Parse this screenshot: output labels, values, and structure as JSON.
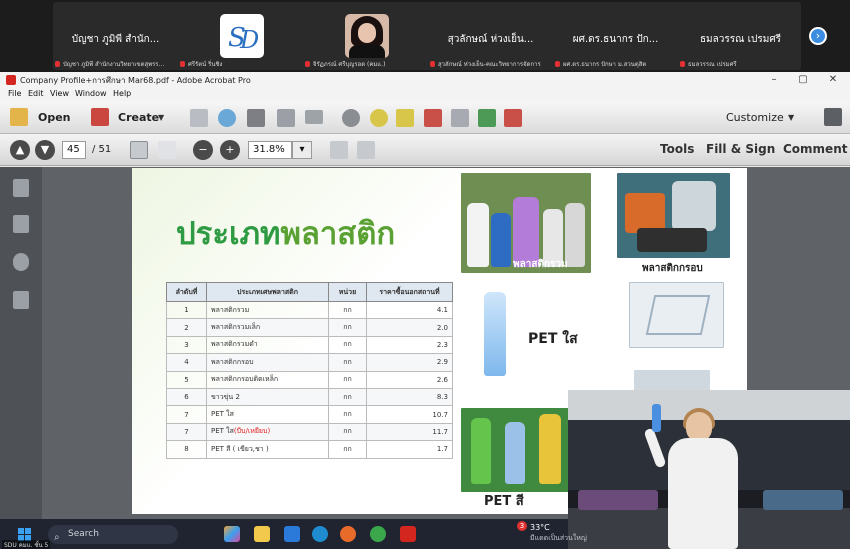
{
  "meeting": {
    "tiles": [
      {
        "name": "บัญชา ภูมิพี สำนัก...",
        "sub": "บัญชา ภูมิพี สำนักงานวิทยาเขตสุพรร..."
      },
      {
        "name": "",
        "sub": "ศรีรัตน์ ริ่นชิง"
      },
      {
        "name": "",
        "sub": "จิรัฏภรณ์ ศรีบุญรอด (คมแ.)"
      },
      {
        "name": "สุวลักษณ์ ห่วงเย็น...",
        "sub": "สุวลักษณ์ ห่วงเย็น-คณะวิทยาการจัดการ"
      },
      {
        "name": "ผศ.ดร.ธนากร ปัก...",
        "sub": "ผศ.ดร.ธนากร ปักษา ม.สวนดุสิต"
      },
      {
        "name": "ธมลวรรณ เปรมศรี",
        "sub": "ธมลวรรณ เปรมศรี"
      }
    ],
    "next_icon": "chevron-right-icon"
  },
  "acrobat": {
    "title": "Company Profile+การศึกษา Mar68.pdf - Adobe Acrobat Pro",
    "window_controls": [
      "–",
      "▢",
      "✕"
    ],
    "menu": [
      "File",
      "Edit",
      "View",
      "Window",
      "Help"
    ],
    "toolbar": {
      "open_label": "Open",
      "create_label": "Create",
      "customize_label": "Customize"
    },
    "nav": {
      "page_current": "45",
      "page_total": "/ 51",
      "zoom": "31.8%",
      "tools_label": "Tools",
      "fill_sign_label": "Fill & Sign",
      "comment_label": "Comment"
    }
  },
  "slide": {
    "title_part1": "ประเภท",
    "title_part2": "พลาสติก",
    "table": {
      "headers": [
        "ลำดับที่",
        "ประเภทเศษพลาสติก",
        "หน่วย",
        "ราคาซื้อนอกสถานที่"
      ],
      "rows": [
        {
          "no": "1",
          "type": "พลาสติกรวม",
          "type_red": "",
          "unit": "กก",
          "price": "4.1"
        },
        {
          "no": "2",
          "type": "พลาสติกรวมเล็ก",
          "type_red": "",
          "unit": "กก",
          "price": "2.0"
        },
        {
          "no": "3",
          "type": "พลาสติกรวมดำ",
          "type_red": "",
          "unit": "กก",
          "price": "2.3"
        },
        {
          "no": "4",
          "type": "พลาสติกกรอบ",
          "type_red": "",
          "unit": "กก",
          "price": "2.9"
        },
        {
          "no": "5",
          "type": "พลาสติกกรอบติดเหล็ก",
          "type_red": "",
          "unit": "กก",
          "price": "2.6"
        },
        {
          "no": "6",
          "type": "ขาวขุ่น 2",
          "type_red": "",
          "unit": "กก",
          "price": "8.3"
        },
        {
          "no": "7",
          "type": "PET ใส",
          "type_red": "",
          "unit": "กก",
          "price": "10.7"
        },
        {
          "no": "7",
          "type": "PET ใส",
          "type_red": "(บีบ/เหยียบ)",
          "unit": "กก",
          "price": "11.7"
        },
        {
          "no": "8",
          "type": "PET สี ( เขียว,ชา )",
          "type_red": "",
          "unit": "กก",
          "price": "1.7"
        }
      ]
    },
    "labels": {
      "mixed": "พลาสติกรวม",
      "brittle": "พลาสติกกรอบ",
      "pet_clear": "PET ใส",
      "pet_color": "PET สี"
    }
  },
  "taskbar": {
    "search_placeholder": "Search",
    "weather_temp": "33°C",
    "weather_desc": "มีแดดเป็นส่วนใหญ่",
    "notif_count": "3",
    "corner_label": "SDU คมแ. ชั้น 5"
  },
  "colors": {
    "title_green": "#1e8a3a",
    "accent_blue": "#3a8de0"
  }
}
